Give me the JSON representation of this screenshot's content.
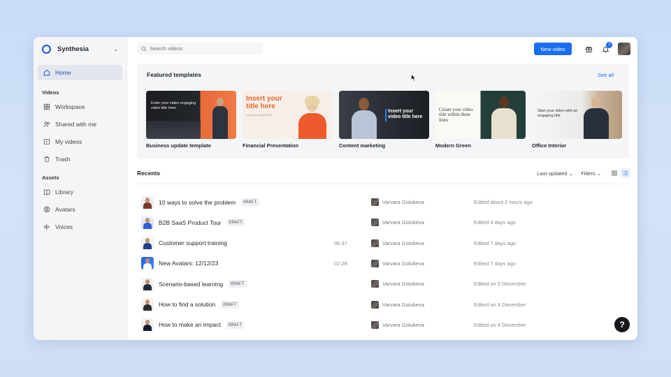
{
  "app": {
    "brand": "Synthesia",
    "accent": "#1a6ef3"
  },
  "sidebar": {
    "home": "Home",
    "videos_section": "Videos",
    "videos": [
      "Workspace",
      "Shared with me",
      "My videos",
      "Trash"
    ],
    "assets_section": "Assets",
    "assets": [
      "Library",
      "Avatars",
      "Voices"
    ]
  },
  "topbar": {
    "search_placeholder": "Search videos",
    "new_video": "New video",
    "notification_count": "7"
  },
  "featured": {
    "title": "Featured templates",
    "see_all": "See all",
    "templates": [
      {
        "name": "Business update template",
        "thumb_text": "Enter your video engaging video title here"
      },
      {
        "name": "Financial Presentation",
        "thumb_text": "Insert your title here",
        "thumb_sub": "create your subtitle here"
      },
      {
        "name": "Content marketing",
        "thumb_text": "Insert your video title here"
      },
      {
        "name": "Modern Green",
        "thumb_text": "Create your video title within three lines"
      },
      {
        "name": "Office Interior",
        "thumb_text": "Start your video with an engaging title"
      }
    ]
  },
  "recents": {
    "title": "Recents",
    "sort_label": "Last updated",
    "filters_label": "Filters",
    "draft_label": "DRAFT",
    "rows": [
      {
        "title": "10 ways to solve the problem",
        "draft": true,
        "duration": "",
        "owner": "Varvara Golubeva",
        "edited": "Edited about 2 hours ago"
      },
      {
        "title": "B2B SaaS Product Tour",
        "draft": true,
        "duration": "",
        "owner": "Varvara Golubeva",
        "edited": "Edited 4 days ago"
      },
      {
        "title": "Customer support training",
        "draft": false,
        "duration": "00:37",
        "owner": "Varvara Golubeva",
        "edited": "Edited 7 days ago"
      },
      {
        "title": "New Avatars: 12/12/23",
        "draft": false,
        "duration": "02:28",
        "owner": "Varvara Golubeva",
        "edited": "Edited 7 days ago"
      },
      {
        "title": "Scenario-based learning",
        "draft": true,
        "duration": "",
        "owner": "Varvara Golubeva",
        "edited": "Edited on 5 December"
      },
      {
        "title": "How to find a solution",
        "draft": true,
        "duration": "",
        "owner": "Varvara Golubeva",
        "edited": "Edited on 4 December"
      },
      {
        "title": "How to make an impact",
        "draft": true,
        "duration": "",
        "owner": "Varvara Golubeva",
        "edited": "Edited on 4 December"
      }
    ]
  },
  "help": "?"
}
